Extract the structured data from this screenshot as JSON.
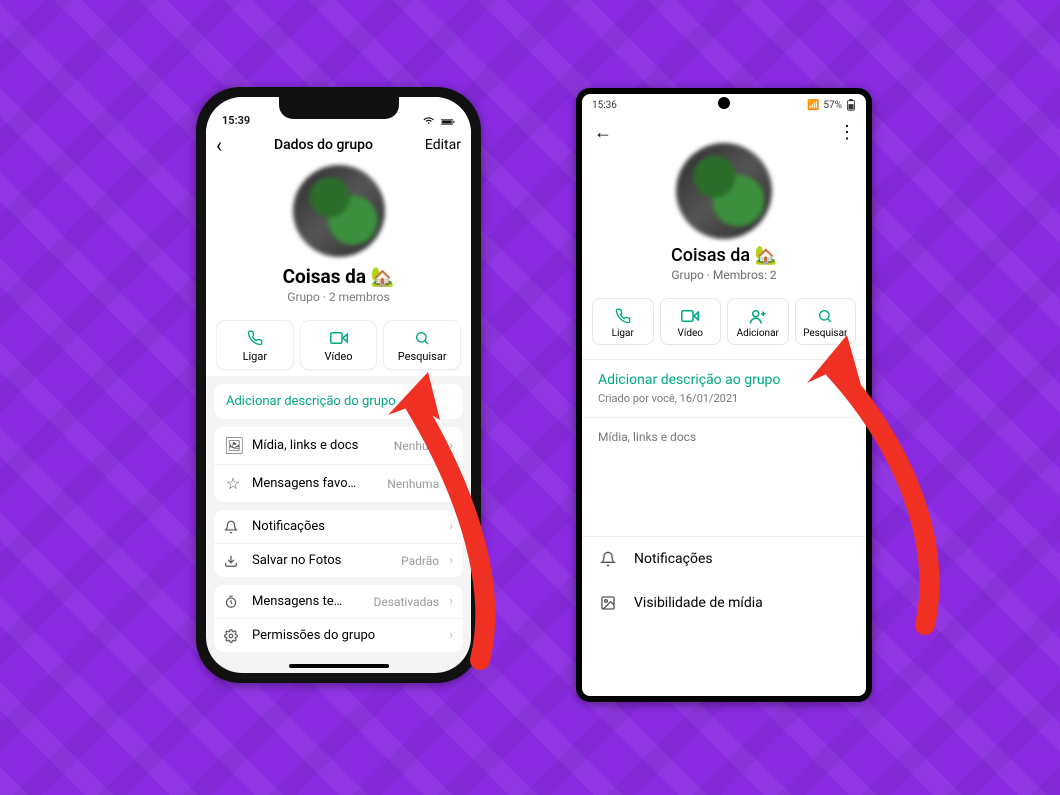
{
  "ios": {
    "status_time": "15:39",
    "header_title": "Dados do grupo",
    "edit_label": "Editar",
    "group_name": "Coisas da 🏡",
    "group_meta": "Grupo · 2 membros",
    "actions": {
      "call": "Ligar",
      "video": "Vídeo",
      "search": "Pesquisar"
    },
    "add_description": "Adicionar descrição do grupo",
    "rows": {
      "media": {
        "label": "Mídia, links e docs",
        "value": "Nenhum"
      },
      "starred": {
        "label": "Mensagens favo…",
        "value": "Nenhuma"
      },
      "notifications": {
        "label": "Notificações"
      },
      "save_photos": {
        "label": "Salvar no Fotos",
        "value": "Padrão"
      },
      "disappearing": {
        "label": "Mensagens te…",
        "value": "Desativadas"
      },
      "permissions": {
        "label": "Permissões do grupo"
      }
    }
  },
  "android": {
    "status_time": "15:36",
    "status_battery": "57%",
    "group_name": "Coisas da 🏡",
    "group_meta": "Grupo · Membros: 2",
    "actions": {
      "call": "Ligar",
      "video": "Vídeo",
      "add": "Adicionar",
      "search": "Pesquisar"
    },
    "add_description": "Adicionar descrição ao grupo",
    "created_by": "Criado por você, 16/01/2021",
    "media_label": "Mídia, links e docs",
    "rows": {
      "notifications": "Notificações",
      "media_visibility": "Visibilidade de mídia"
    }
  }
}
